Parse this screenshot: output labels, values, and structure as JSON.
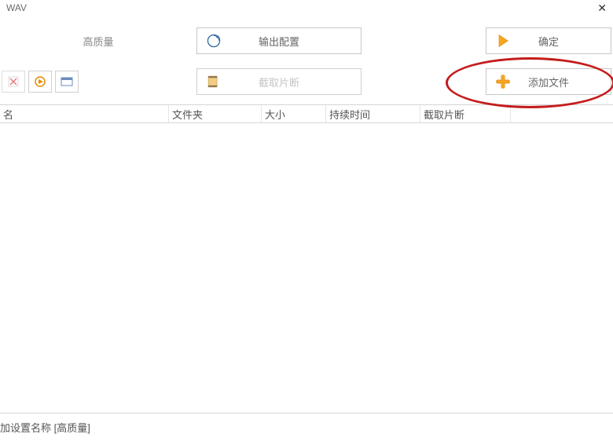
{
  "format_label": "WAV",
  "quality_label": "高质量",
  "buttons": {
    "output_config": "输出配置",
    "ok": "确定",
    "cut_segment": "截取片断",
    "add_file": "添加文件"
  },
  "columns": {
    "name": "名",
    "folder": "文件夹",
    "size": "大小",
    "duration": "持续时间",
    "cut": "截取片断"
  },
  "status": "加设置名称 [高质量]"
}
